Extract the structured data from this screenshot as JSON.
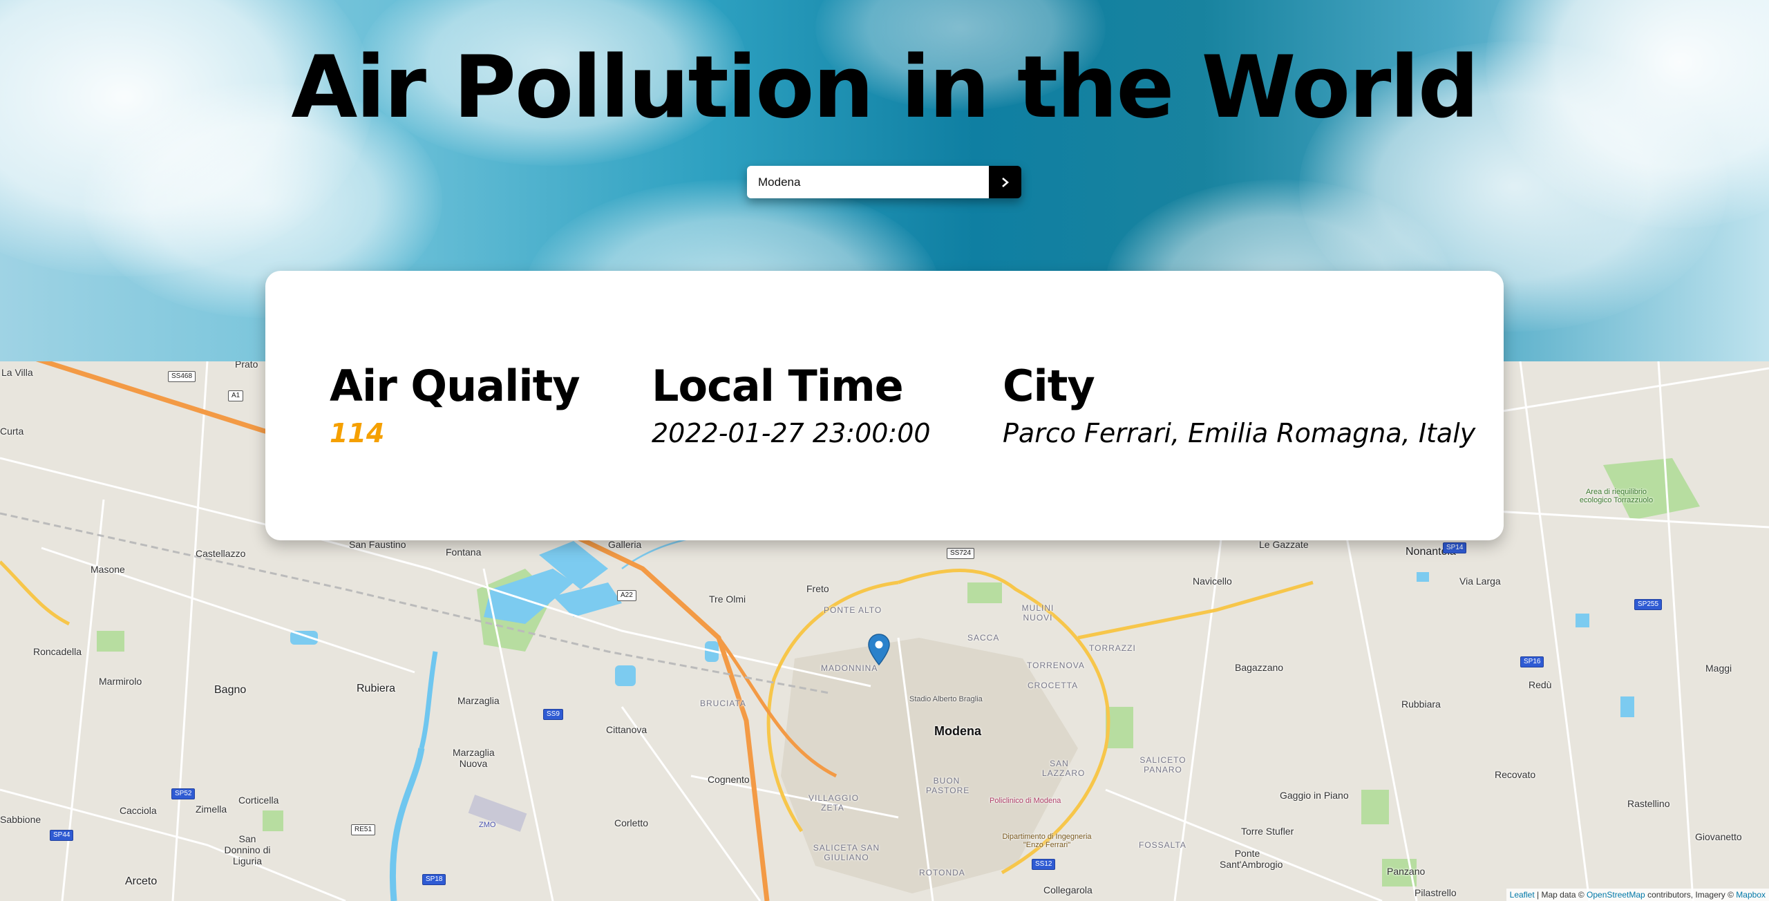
{
  "header": {
    "title": "Air Pollution in the World"
  },
  "search": {
    "value": "Modena",
    "submit_label": ">"
  },
  "card": {
    "air_quality": {
      "label": "Air Quality",
      "value": "114",
      "color": "#f5a000"
    },
    "local_time": {
      "label": "Local Time",
      "value": "2022-01-27 23:00:00"
    },
    "city": {
      "label": "City",
      "value": "Parco Ferrari, Emilia Romagna, Italy"
    }
  },
  "map": {
    "places": [
      {
        "key": "modena",
        "text": "Modena"
      },
      {
        "key": "rubiera",
        "text": "Rubiera"
      },
      {
        "key": "bagno",
        "text": "Bagno"
      },
      {
        "key": "nonantola",
        "text": "Nonantola"
      },
      {
        "key": "castellazzo",
        "text": "Castellazzo"
      },
      {
        "key": "masone",
        "text": "Masone"
      },
      {
        "key": "roncadella",
        "text": "Roncadella"
      },
      {
        "key": "marmirolo",
        "text": "Marmirolo"
      },
      {
        "key": "san_faustino",
        "text": "San Faustino"
      },
      {
        "key": "fontana",
        "text": "Fontana"
      },
      {
        "key": "galleria",
        "text": "Galleria"
      },
      {
        "key": "tre_olmi",
        "text": "Tre Olmi"
      },
      {
        "key": "freto",
        "text": "Freto"
      },
      {
        "key": "marzaglia",
        "text": "Marzaglia"
      },
      {
        "key": "marzaglia_nuova",
        "text": "Marzaglia Nuova"
      },
      {
        "key": "cittanova",
        "text": "Cittanova"
      },
      {
        "key": "cognento",
        "text": "Cognento"
      },
      {
        "key": "corticella",
        "text": "Corticella"
      },
      {
        "key": "zimella",
        "text": "Zimella"
      },
      {
        "key": "cacciola",
        "text": "Cacciola"
      },
      {
        "key": "san_donnino",
        "text": "San Donnino di Liguria"
      },
      {
        "key": "arceto",
        "text": "Arceto"
      },
      {
        "key": "sabbione",
        "text": "Sabbione"
      },
      {
        "key": "corletto",
        "text": "Corletto"
      },
      {
        "key": "collegarola",
        "text": "Collegarola"
      },
      {
        "key": "navicello",
        "text": "Navicello"
      },
      {
        "key": "via_larga",
        "text": "Via Larga"
      },
      {
        "key": "bagazzano",
        "text": "Bagazzano"
      },
      {
        "key": "rubbiara",
        "text": "Rubbiara"
      },
      {
        "key": "redu",
        "text": "Redù"
      },
      {
        "key": "maggi",
        "text": "Maggi"
      },
      {
        "key": "recovato",
        "text": "Recovato"
      },
      {
        "key": "rastellino",
        "text": "Rastellino"
      },
      {
        "key": "giovanetto",
        "text": "Giovanetto"
      },
      {
        "key": "gaggio",
        "text": "Gaggio in Piano"
      },
      {
        "key": "torre_stufler",
        "text": "Torre Stufler"
      },
      {
        "key": "ponte_santambrogio",
        "text": "Ponte Sant'Ambrogio"
      },
      {
        "key": "panzano",
        "text": "Panzano"
      },
      {
        "key": "pilastrello",
        "text": "Pilastrello"
      },
      {
        "key": "le_gazzate",
        "text": "Le Gazzate"
      },
      {
        "key": "la_villa",
        "text": "La Villa"
      },
      {
        "key": "curta",
        "text": "Curta"
      },
      {
        "key": "prato",
        "text": "Prato"
      }
    ],
    "districts": [
      {
        "key": "ponte_alto",
        "text": "PONTE ALTO"
      },
      {
        "key": "madonnina",
        "text": "MADONNINA"
      },
      {
        "key": "sacca",
        "text": "SACCA"
      },
      {
        "key": "mulini_nuovi",
        "text": "MULINI NUOVI"
      },
      {
        "key": "torrazzi",
        "text": "TORRAZZI"
      },
      {
        "key": "torrenova",
        "text": "TORRENOVA"
      },
      {
        "key": "crocetta",
        "text": "CROCETTA"
      },
      {
        "key": "bruciata",
        "text": "BRUCIATA"
      },
      {
        "key": "san_lazzaro",
        "text": "SAN LAZZARO"
      },
      {
        "key": "saliceto_panaro",
        "text": "SALICETO PANARO"
      },
      {
        "key": "buon_pastore",
        "text": "BUON PASTORE"
      },
      {
        "key": "villaggio_zeta",
        "text": "VILLAGGIO ZETA"
      },
      {
        "key": "saliceta",
        "text": "SALICETA SAN GIULIANO"
      },
      {
        "key": "rotonda",
        "text": "ROTONDA"
      },
      {
        "key": "fossalta",
        "text": "FOSSALTA"
      }
    ],
    "pois": [
      {
        "key": "stadio",
        "text": "Stadio Alberto Braglia"
      },
      {
        "key": "policlinico",
        "text": "Policlinico di Modena"
      },
      {
        "key": "ingegneria",
        "text": "Dipartimento di Ingegneria \"Enzo Ferrari\""
      },
      {
        "key": "area_riequilibrio",
        "text": "Area di riequilibrio ecologico Torrazzuolo"
      },
      {
        "key": "zmo",
        "text": "ZMO"
      }
    ],
    "shields": [
      "SS468",
      "A1",
      "A22",
      "SS724",
      "SP14",
      "SP255",
      "SS9",
      "SP16",
      "SS12",
      "RE51",
      "SP44",
      "SP52",
      "SP18"
    ],
    "attribution": {
      "leaflet": "Leaflet",
      "sep1": " | Map data © ",
      "osm": "OpenStreetMap",
      "sep2": " contributors, Imagery © ",
      "mapbox": "Mapbox"
    },
    "colors": {
      "motorway": "#f0a04a",
      "primary": "#f8c84a",
      "water": "#6fc6ef",
      "park": "#a8d98a"
    }
  }
}
